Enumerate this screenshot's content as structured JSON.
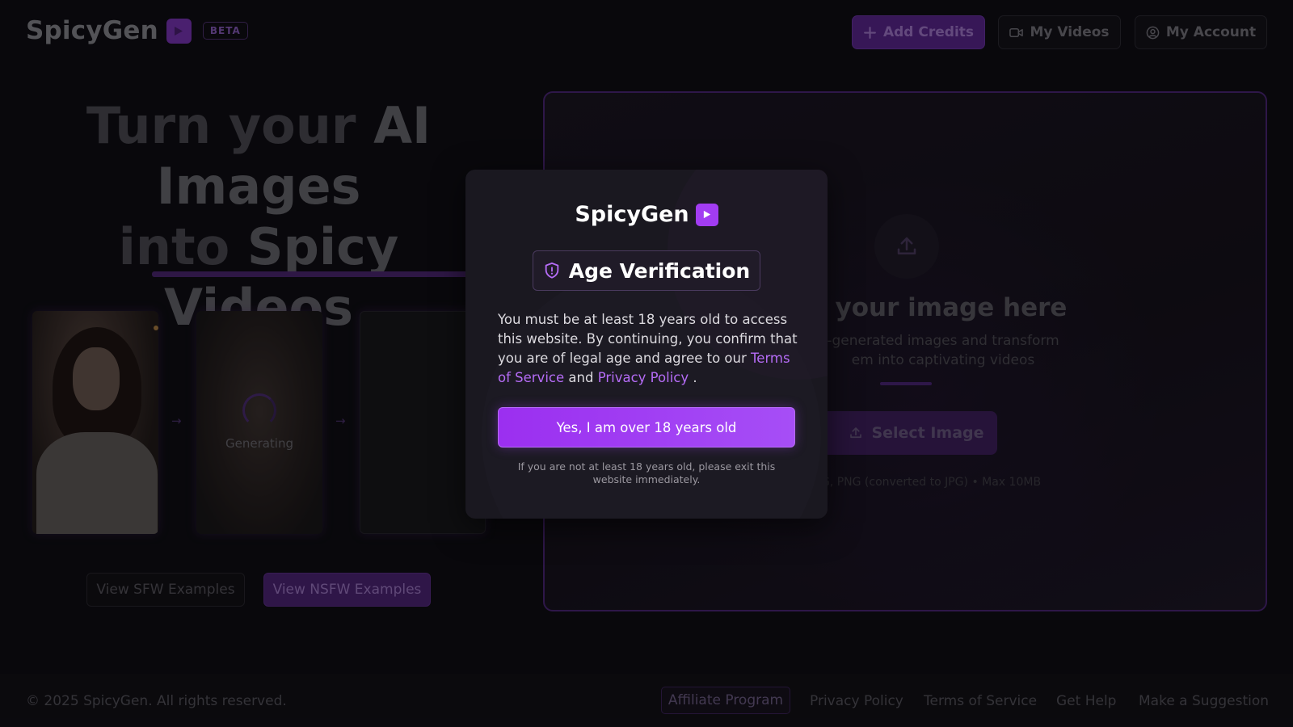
{
  "header": {
    "brand": "SpicyGen",
    "beta": "BETA",
    "add_credits": "Add Credits",
    "my_videos": "My Videos",
    "my_account": "My Account"
  },
  "hero": {
    "line1a": "Turn your ",
    "line1b": "AI",
    "line2": "Images",
    "line3a": "into ",
    "line3b": "Spicy Videos",
    "generating": "Generating",
    "arrow": "→",
    "view_sfw": "View SFW Examples",
    "view_nsfw": "View NSFW Examples"
  },
  "upload": {
    "heading": "your image here",
    "sub_line1": "-generated images and transform",
    "sub_line2": "em into captivating videos",
    "select_button": "Select Image",
    "formats": "G, PNG (converted to JPG) • Max 10MB"
  },
  "footer": {
    "copyright": "© 2025 SpicyGen. All rights reserved.",
    "affiliate": "Affiliate Program",
    "privacy": "Privacy Policy",
    "terms": "Terms of Service",
    "help": "Get Help",
    "suggestion": "Make a Suggestion"
  },
  "modal": {
    "brand": "SpicyGen",
    "title": "Age Verification",
    "text_before": "You must be at least 18 years old to access this website. By continuing, you confirm that you are of legal age and agree to our ",
    "terms_link": "Terms of Service",
    "and": " and ",
    "privacy_link": "Privacy Policy",
    "text_after": " .",
    "confirm_button": "Yes, I am over 18 years old",
    "note": "If you are not at least 18 years old, please exit this website immediately."
  },
  "colors": {
    "accent": "#a23cf2",
    "accent_dark": "#5a2490",
    "background": "#0b0a0e",
    "link": "#b56cf6"
  },
  "icons": [
    "play-icon",
    "plus-icon",
    "video-camera-icon",
    "user-circle-icon",
    "upload-icon",
    "shield-icon",
    "arrow-right-icon"
  ]
}
